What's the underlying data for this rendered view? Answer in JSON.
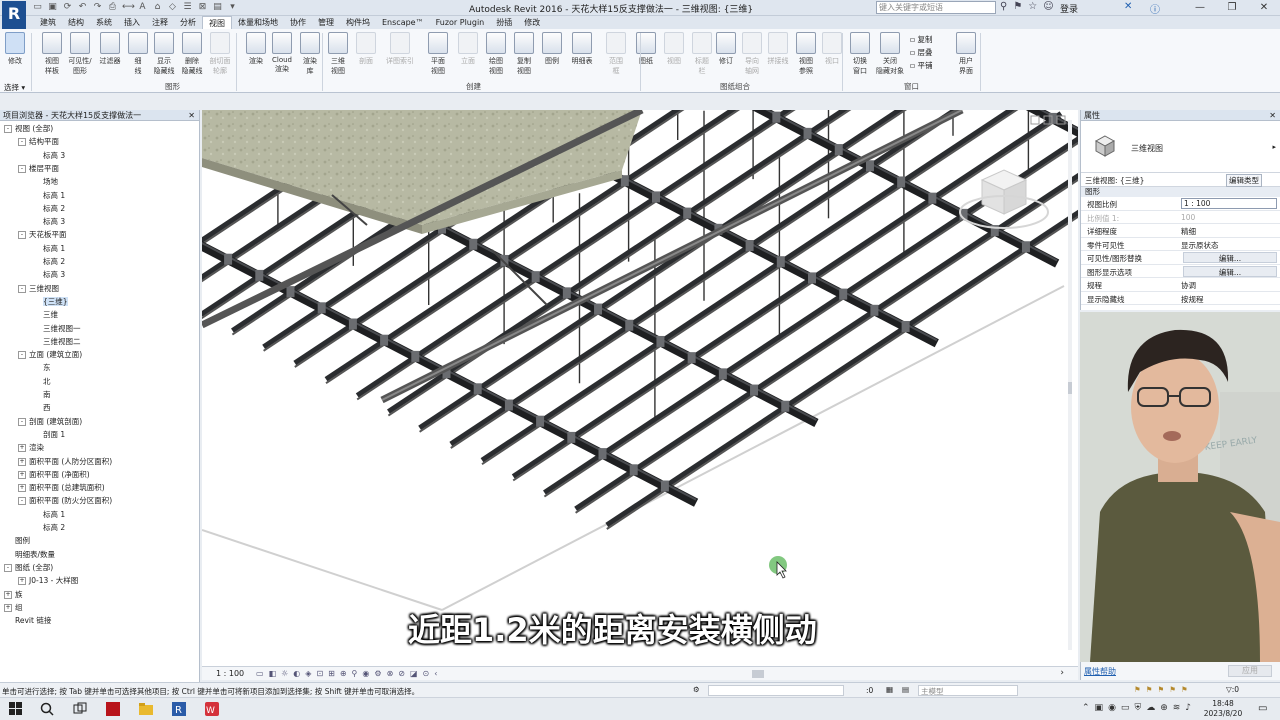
{
  "titlebar": {
    "logo": "R",
    "title": "Autodesk Revit 2016 -    天花大样15反支撑做法一 - 三维视图: {三维}",
    "search_placeholder": "键入关键字或短语",
    "login": "登录"
  },
  "tabs": [
    "建筑",
    "结构",
    "系统",
    "插入",
    "注释",
    "分析",
    "视图",
    "体量和场地",
    "协作",
    "管理",
    "构件坞",
    "Enscape™",
    "Fuzor Plugin",
    "扮插",
    "修改"
  ],
  "active_tab": "视图",
  "ribbon": {
    "modify": "修改",
    "select_dropdown": "选择 ▾",
    "tools": [
      {
        "label": "视图\n样板",
        "dim": false
      },
      {
        "label": "可见性/\n图形",
        "dim": false
      },
      {
        "label": "过滤器",
        "dim": false
      },
      {
        "label": "细\n线",
        "dim": false
      },
      {
        "label": "显示\n隐藏线",
        "dim": false
      },
      {
        "label": "删除\n隐藏线",
        "dim": false
      },
      {
        "label": "剖切面\n轮廓",
        "dim": true
      },
      {
        "label": "渲染",
        "dim": false
      },
      {
        "label": "Cloud\n渲染",
        "dim": false
      },
      {
        "label": "渲染\n库",
        "dim": false
      },
      {
        "label": "三维\n视图",
        "dim": false
      },
      {
        "label": "剖面",
        "dim": true
      },
      {
        "label": "详图索引",
        "dim": true
      },
      {
        "label": "平面\n视图",
        "dim": false
      },
      {
        "label": "立面",
        "dim": true
      },
      {
        "label": "绘图\n视图",
        "dim": false
      },
      {
        "label": "复制\n视图",
        "dim": false
      },
      {
        "label": "图例",
        "dim": false
      },
      {
        "label": "明细表",
        "dim": false
      },
      {
        "label": "范围\n框",
        "dim": true
      },
      {
        "label": "图纸",
        "dim": false
      },
      {
        "label": "视图",
        "dim": true
      },
      {
        "label": "标题\n栏",
        "dim": true
      },
      {
        "label": "修订",
        "dim": false
      },
      {
        "label": "导向\n轴网",
        "dim": true
      },
      {
        "label": "拼接线",
        "dim": true
      },
      {
        "label": "视图\n参照",
        "dim": false
      },
      {
        "label": "视口",
        "dim": true
      },
      {
        "label": "切换\n窗口",
        "dim": false
      },
      {
        "label": "关闭\n隐藏对象",
        "dim": false
      },
      {
        "label": "用户\n界面",
        "dim": false
      }
    ],
    "window_small": [
      "复制",
      "层叠",
      "平铺"
    ],
    "panels": [
      "图形",
      "创建",
      "图纸组合",
      "窗口"
    ]
  },
  "browser": {
    "title": "项目浏览器 - 天花大样15反支撑做法一",
    "close": "✕",
    "items": [
      {
        "label": "视图 (全部)",
        "level": 0,
        "toggle": "-"
      },
      {
        "label": "结构平面",
        "level": 1,
        "toggle": "-"
      },
      {
        "label": "标高 3",
        "level": 2,
        "toggle": ""
      },
      {
        "label": "楼层平面",
        "level": 1,
        "toggle": "-"
      },
      {
        "label": "场地",
        "level": 2,
        "toggle": ""
      },
      {
        "label": "标高 1",
        "level": 2,
        "toggle": ""
      },
      {
        "label": "标高 2",
        "level": 2,
        "toggle": ""
      },
      {
        "label": "标高 3",
        "level": 2,
        "toggle": ""
      },
      {
        "label": "天花板平面",
        "level": 1,
        "toggle": "-"
      },
      {
        "label": "标高 1",
        "level": 2,
        "toggle": ""
      },
      {
        "label": "标高 2",
        "level": 2,
        "toggle": ""
      },
      {
        "label": "标高 3",
        "level": 2,
        "toggle": ""
      },
      {
        "label": "三维视图",
        "level": 1,
        "toggle": "-"
      },
      {
        "label": "{三维}",
        "level": 2,
        "toggle": "",
        "selected": true
      },
      {
        "label": "三维",
        "level": 2,
        "toggle": ""
      },
      {
        "label": "三维视图一",
        "level": 2,
        "toggle": ""
      },
      {
        "label": "三维视图二",
        "level": 2,
        "toggle": ""
      },
      {
        "label": "立面 (建筑立面)",
        "level": 1,
        "toggle": "-"
      },
      {
        "label": "东",
        "level": 2,
        "toggle": ""
      },
      {
        "label": "北",
        "level": 2,
        "toggle": ""
      },
      {
        "label": "南",
        "level": 2,
        "toggle": ""
      },
      {
        "label": "西",
        "level": 2,
        "toggle": ""
      },
      {
        "label": "剖面 (建筑剖面)",
        "level": 1,
        "toggle": "-"
      },
      {
        "label": "剖面 1",
        "level": 2,
        "toggle": ""
      },
      {
        "label": "渲染",
        "level": 1,
        "toggle": "+"
      },
      {
        "label": "面积平面 (人防分区面积)",
        "level": 1,
        "toggle": "+"
      },
      {
        "label": "面积平面 (净面积)",
        "level": 1,
        "toggle": "+"
      },
      {
        "label": "面积平面 (总建筑面积)",
        "level": 1,
        "toggle": "+"
      },
      {
        "label": "面积平面 (防火分区面积)",
        "level": 1,
        "toggle": "-"
      },
      {
        "label": "标高 1",
        "level": 2,
        "toggle": ""
      },
      {
        "label": "标高 2",
        "level": 2,
        "toggle": ""
      },
      {
        "label": "图例",
        "level": 0,
        "toggle": ""
      },
      {
        "label": "明细表/数量",
        "level": 0,
        "toggle": ""
      },
      {
        "label": "图纸 (全部)",
        "level": 0,
        "toggle": "-"
      },
      {
        "label": "J0-13 - 大样图",
        "level": 1,
        "toggle": "+"
      },
      {
        "label": "族",
        "level": 0,
        "toggle": "+"
      },
      {
        "label": "组",
        "level": 0,
        "toggle": "+"
      },
      {
        "label": "Revit 链接",
        "level": 0,
        "toggle": ""
      }
    ]
  },
  "viewport": {
    "scale": "1 : 100",
    "subtitle": "近距1.2米的距离安装横侧动"
  },
  "properties": {
    "title": "属性",
    "close": "✕",
    "type_name": "三维视图",
    "view_selector": "三维视图: {三维}",
    "edit_type": "编辑类型",
    "category": "图形",
    "rows": [
      {
        "k": "视图比例",
        "v": "1 : 100",
        "style": "box"
      },
      {
        "k": "比例值 1:",
        "v": "100",
        "style": "dim"
      },
      {
        "k": "详细程度",
        "v": "精细",
        "style": ""
      },
      {
        "k": "零件可见性",
        "v": "显示原状态",
        "style": ""
      },
      {
        "k": "可见性/图形替换",
        "v": "编辑...",
        "style": "btn"
      },
      {
        "k": "图形显示选项",
        "v": "编辑...",
        "style": "btn"
      },
      {
        "k": "规程",
        "v": "协调",
        "style": ""
      },
      {
        "k": "显示隐藏线",
        "v": "按规程",
        "style": ""
      }
    ],
    "help_link": "属性帮助",
    "apply": "应用"
  },
  "statusbar": {
    "message": "单击可进行选择; 按 Tab 键并单击可选择其他项目; 按 Ctrl 键并单击可将新项目添加到选择集; 按 Shift 键并单击可取消选择。",
    "zero": ":0",
    "model": "主模型",
    "filter": "▽:0"
  },
  "taskbar": {
    "time": "18:48",
    "date": "2023/8/20"
  },
  "colors": {
    "accent": "#1d4f91",
    "beam": "#2a2c2f",
    "slab": "#b9bba4"
  }
}
